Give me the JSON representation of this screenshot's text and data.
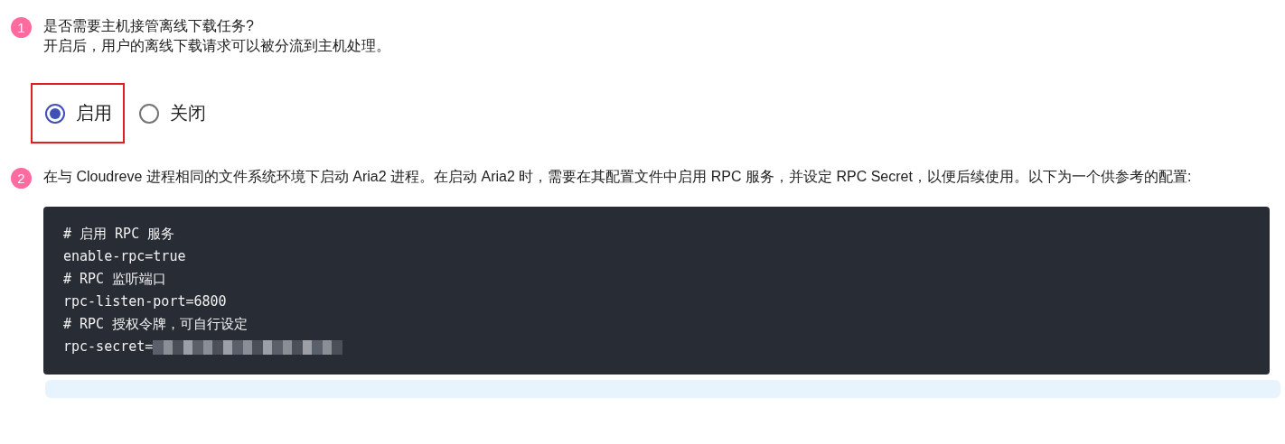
{
  "steps": [
    {
      "number": "1",
      "title": "是否需要主机接管离线下载任务?",
      "description": "开启后，用户的离线下载请求可以被分流到主机处理。",
      "options": [
        {
          "label": "启用",
          "selected": true,
          "annotated": true
        },
        {
          "label": "关闭",
          "selected": false,
          "annotated": false
        }
      ]
    },
    {
      "number": "2",
      "text": "在与 Cloudreve 进程相同的文件系统环境下启动 Aria2 进程。在启动 Aria2 时，需要在其配置文件中启用 RPC 服务，并设定 RPC Secret，以便后续使用。以下为一个供参考的配置:",
      "code_lines": [
        {
          "text": "# 启用 RPC 服务",
          "masked": false
        },
        {
          "text": "enable-rpc=true",
          "masked": false
        },
        {
          "text": "# RPC 监听端口",
          "masked": false
        },
        {
          "text": "rpc-listen-port=6800",
          "masked": false
        },
        {
          "text": "# RPC 授权令牌，可自行设定",
          "masked": false
        },
        {
          "text": "rpc-secret=",
          "masked": true
        }
      ]
    }
  ]
}
